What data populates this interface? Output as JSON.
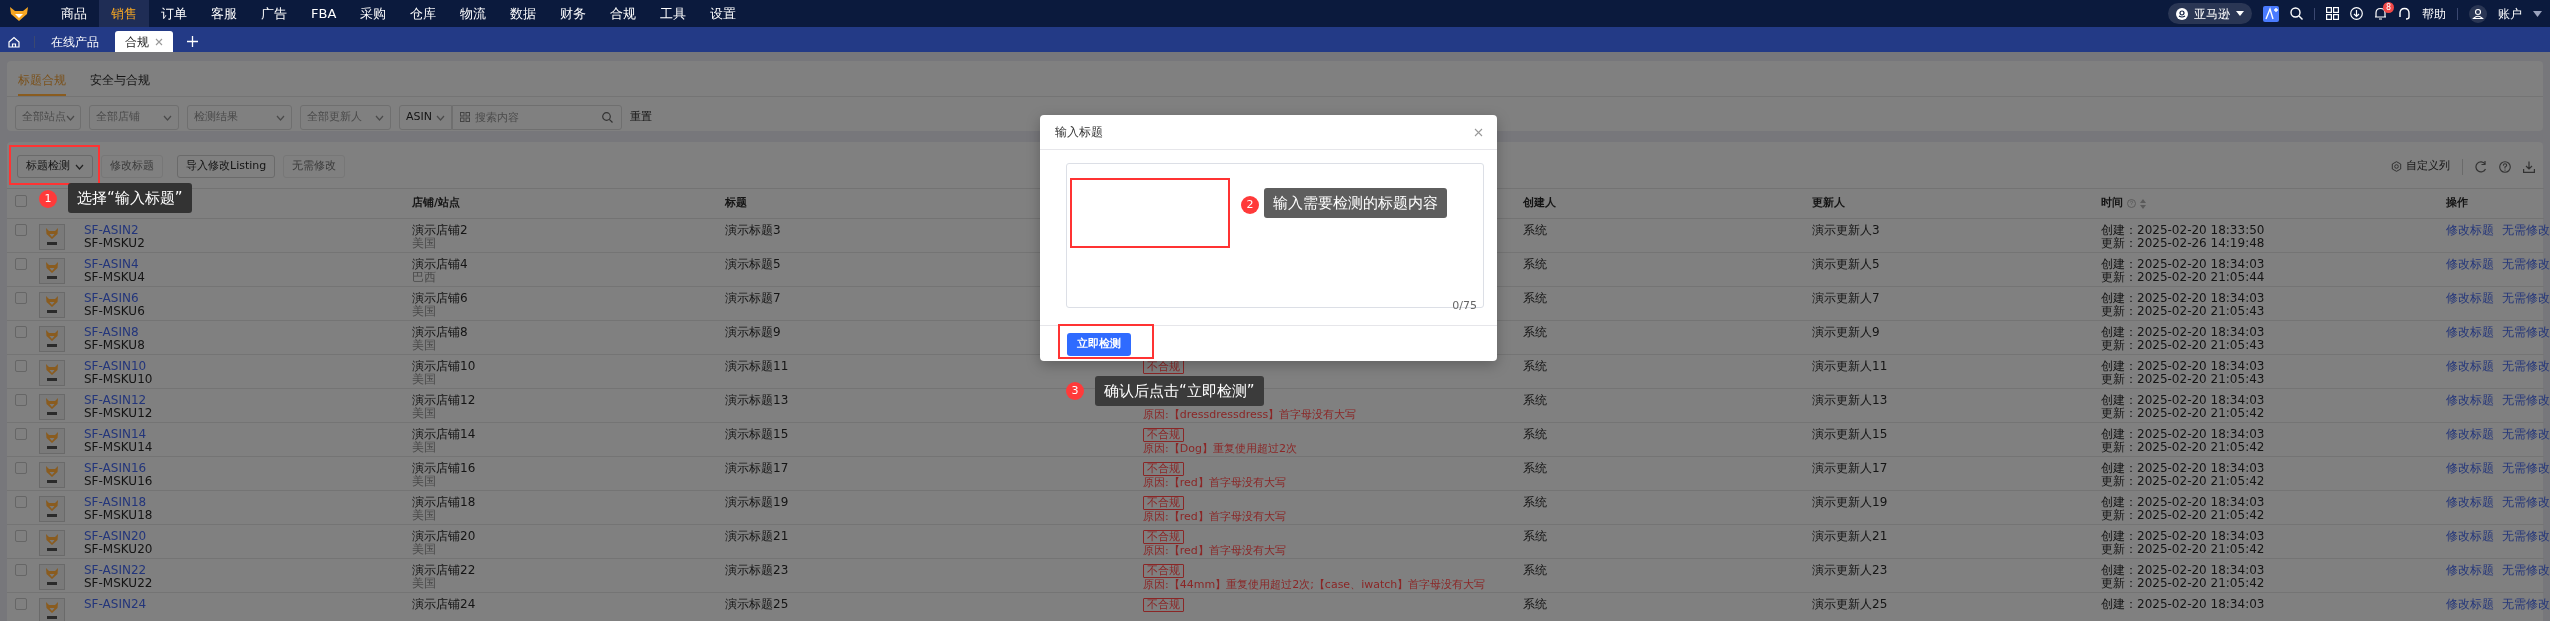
{
  "nav": {
    "menu": [
      {
        "label": "商品",
        "selected": false
      },
      {
        "label": "销售",
        "selected": true
      },
      {
        "label": "订单",
        "selected": false
      },
      {
        "label": "客服",
        "selected": false
      },
      {
        "label": "广告",
        "selected": false
      },
      {
        "label": "FBA",
        "selected": false
      },
      {
        "label": "采购",
        "selected": false
      },
      {
        "label": "仓库",
        "selected": false
      },
      {
        "label": "物流",
        "selected": false
      },
      {
        "label": "数据",
        "selected": false
      },
      {
        "label": "财务",
        "selected": false
      },
      {
        "label": "合规",
        "selected": false
      },
      {
        "label": "工具",
        "selected": false
      },
      {
        "label": "设置",
        "selected": false
      }
    ],
    "platform": "亚马逊",
    "notifications": "8",
    "help": "帮助",
    "account": "账户"
  },
  "page_tabs": [
    {
      "label": "在线产品",
      "selected": false,
      "closable": false
    },
    {
      "label": "合规",
      "selected": true,
      "closable": true
    }
  ],
  "sub_tabs": [
    {
      "label": "标题合规",
      "selected": true
    },
    {
      "label": "安全与合规",
      "selected": false
    }
  ],
  "filters": [
    {
      "kind": "select",
      "placeholder": "全部站点"
    },
    {
      "kind": "select",
      "placeholder": "全部店铺"
    },
    {
      "kind": "select",
      "placeholder": "检测结果"
    },
    {
      "kind": "select",
      "placeholder": "全部更新人"
    },
    {
      "kind": "select",
      "value": "ASIN"
    },
    {
      "kind": "search",
      "placeholder": "搜索内容"
    }
  ],
  "reset": "重置",
  "toolbar": {
    "buttons": [
      {
        "label": "标题检测",
        "disabled": false,
        "dropdown": true
      },
      {
        "label": "修改标题",
        "disabled": true,
        "dropdown": false
      },
      {
        "label": "导入修改Listing",
        "disabled": false,
        "dropdown": false
      },
      {
        "label": "无需修改",
        "disabled": true,
        "dropdown": false
      }
    ],
    "customize": "自定义列"
  },
  "table": {
    "header_checked": false,
    "columns": [
      {
        "label": "店铺/站点",
        "sortable": false
      },
      {
        "label": "标题",
        "sortable": false
      },
      {
        "label": "创建人",
        "sortable": false
      },
      {
        "label": "更新人",
        "sortable": false
      },
      {
        "label": "时间",
        "sortable": true
      },
      {
        "label": "操作",
        "sortable": false
      }
    ],
    "rows": [
      {
        "checked": false,
        "asin": "SF-ASIN2",
        "msku": "SF-MSKU2",
        "store": "演示店铺2",
        "site": "美国",
        "title": "演示标题3",
        "creator": "系统",
        "updater": "演示更新人3",
        "created": "创建：2025-02-20 18:33:50",
        "updated": "更新：2025-02-26 14:19:48",
        "actions": [
          "修改标题",
          "无需修改"
        ]
      },
      {
        "checked": false,
        "asin": "SF-ASIN4",
        "msku": "SF-MSKU4",
        "store": "演示店铺4",
        "site": "巴西",
        "title": "演示标题5",
        "creator": "系统",
        "updater": "演示更新人5",
        "created": "创建：2025-02-20 18:34:03",
        "updated": "更新：2025-02-20 21:05:44",
        "actions": [
          "修改标题",
          "无需修改"
        ]
      },
      {
        "checked": false,
        "asin": "SF-ASIN6",
        "msku": "SF-MSKU6",
        "store": "演示店铺6",
        "site": "美国",
        "title": "演示标题7",
        "creator": "系统",
        "updater": "演示更新人7",
        "created": "创建：2025-02-20 18:34:03",
        "updated": "更新：2025-02-20 21:05:43",
        "actions": [
          "修改标题",
          "无需修改"
        ]
      },
      {
        "checked": false,
        "asin": "SF-ASIN8",
        "msku": "SF-MSKU8",
        "store": "演示店铺8",
        "site": "美国",
        "title": "演示标题9",
        "creator": "系统",
        "updater": "演示更新人9",
        "created": "创建：2025-02-20 18:34:03",
        "updated": "更新：2025-02-20 21:05:43",
        "actions": [
          "修改标题",
          "无需修改"
        ]
      },
      {
        "checked": false,
        "asin": "SF-ASIN10",
        "msku": "SF-MSKU10",
        "store": "演示店铺10",
        "site": "美国",
        "title": "演示标题11",
        "result": "不合规",
        "creator": "系统",
        "updater": "演示更新人11",
        "created": "创建：2025-02-20 18:34:03",
        "updated": "更新：2025-02-20 21:05:43",
        "actions": [
          "修改标题",
          "无需修改"
        ]
      },
      {
        "checked": false,
        "asin": "SF-ASIN12",
        "msku": "SF-MSKU12",
        "store": "演示店铺12",
        "site": "美国",
        "title": "演示标题13",
        "reason": "原因:【dressdressdress】首字母没有大写",
        "creator": "系统",
        "updater": "演示更新人13",
        "created": "创建：2025-02-20 18:34:03",
        "updated": "更新：2025-02-20 21:05:42",
        "actions": [
          "修改标题",
          "无需修改"
        ]
      },
      {
        "checked": false,
        "asin": "SF-ASIN14",
        "msku": "SF-MSKU14",
        "store": "演示店铺14",
        "site": "美国",
        "title": "演示标题15",
        "result": "不合规",
        "reason": "原因:【Dog】重复使用超过2次",
        "creator": "系统",
        "updater": "演示更新人15",
        "created": "创建：2025-02-20 18:34:03",
        "updated": "更新：2025-02-20 21:05:42",
        "actions": [
          "修改标题",
          "无需修改"
        ]
      },
      {
        "checked": false,
        "asin": "SF-ASIN16",
        "msku": "SF-MSKU16",
        "store": "演示店铺16",
        "site": "美国",
        "title": "演示标题17",
        "result": "不合规",
        "reason": "原因:【red】首字母没有大写",
        "creator": "系统",
        "updater": "演示更新人17",
        "created": "创建：2025-02-20 18:34:03",
        "updated": "更新：2025-02-20 21:05:42",
        "actions": [
          "修改标题",
          "无需修改"
        ]
      },
      {
        "checked": false,
        "asin": "SF-ASIN18",
        "msku": "SF-MSKU18",
        "store": "演示店铺18",
        "site": "美国",
        "title": "演示标题19",
        "result": "不合规",
        "reason": "原因:【red】首字母没有大写",
        "creator": "系统",
        "updater": "演示更新人19",
        "created": "创建：2025-02-20 18:34:03",
        "updated": "更新：2025-02-20 21:05:42",
        "actions": [
          "修改标题",
          "无需修改"
        ]
      },
      {
        "checked": false,
        "asin": "SF-ASIN20",
        "msku": "SF-MSKU20",
        "store": "演示店铺20",
        "site": "美国",
        "title": "演示标题21",
        "result": "不合规",
        "reason": "原因:【red】首字母没有大写",
        "creator": "系统",
        "updater": "演示更新人21",
        "created": "创建：2025-02-20 18:34:03",
        "updated": "更新：2025-02-20 21:05:42",
        "actions": [
          "修改标题",
          "无需修改"
        ]
      },
      {
        "checked": false,
        "asin": "SF-ASIN22",
        "msku": "SF-MSKU22",
        "store": "演示店铺22",
        "site": "美国",
        "title": "演示标题23",
        "result": "不合规",
        "reason": "原因:【44mm】重复使用超过2次;【case、iwatch】首字母没有大写",
        "creator": "系统",
        "updater": "演示更新人23",
        "created": "创建：2025-02-20 18:34:03",
        "updated": "更新：2025-02-20 21:05:42",
        "actions": [
          "修改标题",
          "无需修改"
        ]
      },
      {
        "checked": false,
        "asin": "SF-ASIN24",
        "store": "演示店铺24",
        "title": "演示标题25",
        "result": "不合规",
        "creator": "系统",
        "updater": "演示更新人25",
        "created": "创建：2025-02-20 18:34:03",
        "actions": [
          "修改标题",
          "无需修改"
        ]
      }
    ]
  },
  "modal": {
    "title": "输入标题",
    "counter": "0/75",
    "button": "立即检测"
  },
  "annotations": [
    {
      "number": "1",
      "text": "选择“输入标题”"
    },
    {
      "number": "2",
      "text": "输入需要检测的标题内容"
    },
    {
      "number": "3",
      "text": "确认后点击“立即检测”"
    }
  ]
}
